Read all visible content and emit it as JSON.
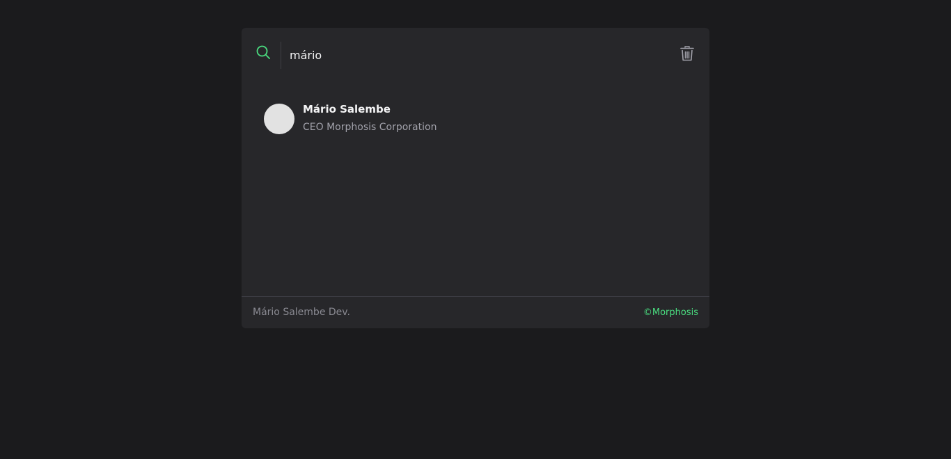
{
  "search": {
    "value": "mário",
    "icon": "search-icon",
    "clear_icon": "trash-icon"
  },
  "results": [
    {
      "name": "Mário Salembe",
      "subtitle": "CEO Morphosis Corporation"
    }
  ],
  "footer": {
    "left_text": "Mário Salembe Dev.",
    "right_text": "©Morphosis"
  },
  "colors": {
    "background": "#1b1b1d",
    "panel": "#27272a",
    "accent": "#4ade80",
    "avatar": "#e2e2e2"
  }
}
